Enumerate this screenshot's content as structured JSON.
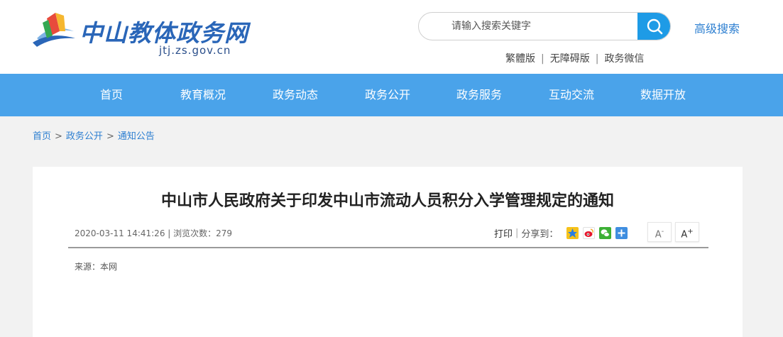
{
  "site": {
    "title": "中山教体政务网",
    "domain": "jtj.zs.gov.cn"
  },
  "search": {
    "placeholder": "请输入搜索关键字",
    "advanced_label": "高级搜索"
  },
  "top_links": [
    {
      "label": "繁體版"
    },
    {
      "label": "无障碍版"
    },
    {
      "label": "政务微信"
    }
  ],
  "nav": [
    {
      "label": "首页"
    },
    {
      "label": "教育概况"
    },
    {
      "label": "政务动态"
    },
    {
      "label": "政务公开"
    },
    {
      "label": "政务服务"
    },
    {
      "label": "互动交流"
    },
    {
      "label": "数据开放"
    }
  ],
  "breadcrumb": [
    {
      "label": "首页"
    },
    {
      "label": "政务公开"
    },
    {
      "label": "通知公告"
    }
  ],
  "article": {
    "title": "中山市人民政府关于印发中山市流动人员积分入学管理规定的通知",
    "meta": "2020-03-11 14:41:26 | 浏览次数：279",
    "print_label": "打印",
    "share_label": "分享到：",
    "font_decrease_label": "A",
    "font_increase_label": "A",
    "source": "来源：本网"
  },
  "colors": {
    "nav_bg": "#4aa3ea",
    "search_button": "#1e9be6",
    "link": "#2d7fd1",
    "logo_blue": "#2a66b8"
  },
  "icons": [
    "search-icon",
    "qzone-icon",
    "weibo-icon",
    "wechat-icon",
    "more-share-icon"
  ]
}
